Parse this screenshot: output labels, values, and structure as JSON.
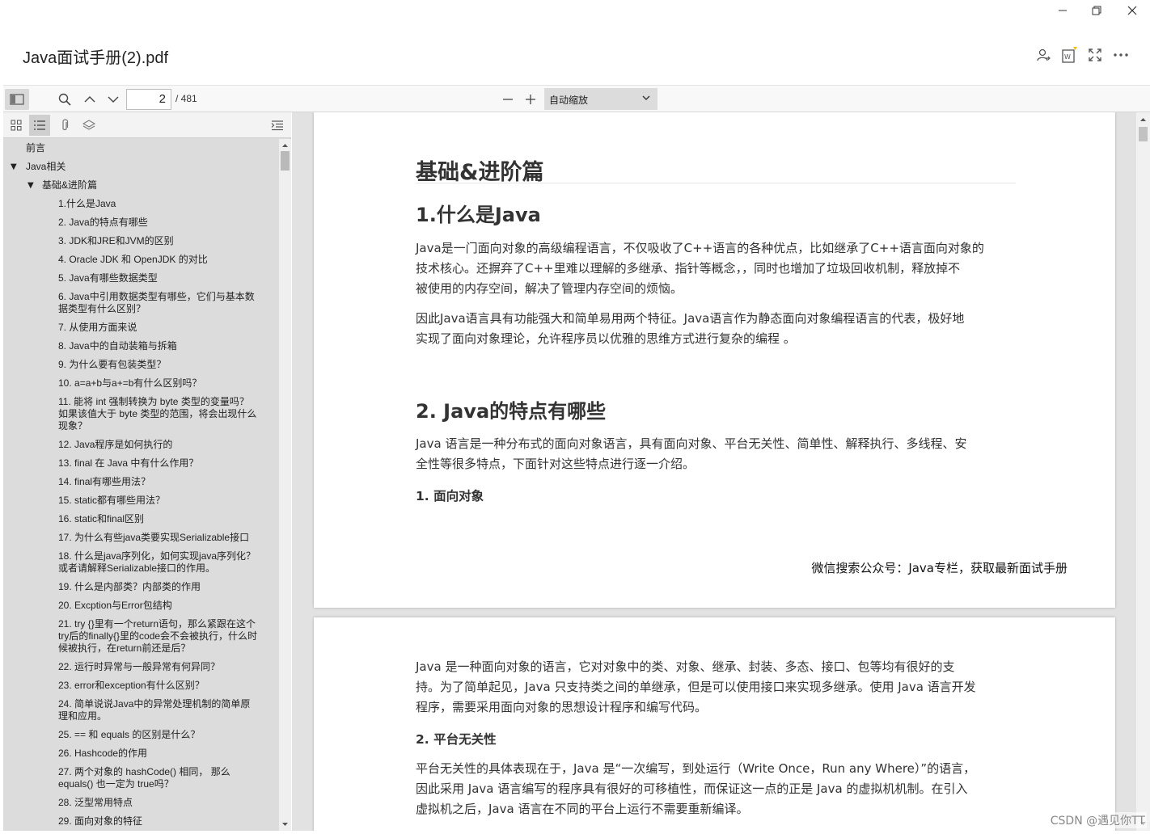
{
  "window": {
    "doc_title": "Java面试手册(2).pdf",
    "minimize_icon": "minimize-icon",
    "restore_icon": "restore-icon",
    "close_icon": "close-icon"
  },
  "toolbar": {
    "page_current": "2",
    "page_total": "/ 481",
    "zoom_label": "自动缩放"
  },
  "outline": {
    "items": [
      "前言",
      "Java相关",
      "基础&进阶篇",
      "1.什么是Java",
      "2. Java的特点有哪些",
      "3. JDK和JRE和JVM的区别",
      "4. Oracle JDK 和 OpenJDK 的对比",
      "5. Java有哪些数据类型",
      "6. Java中引用数据类型有哪些，它们与基本数",
      "据类型有什么区别？",
      "7. 从使用方面来说",
      "8. Java中的自动装箱与拆箱",
      "9. 为什么要有包装类型？",
      "10. a=a+b与a+=b有什么区别吗？",
      "11. 能将 int 强制转换为 byte 类型的变量吗？",
      "如果该值大于 byte 类型的范围，将会出现什么",
      "现象？",
      "12. Java程序是如何执行的",
      "13. final 在 Java 中有什么作用？",
      "14. final有哪些用法？",
      "15. static都有哪些用法？",
      "16. static和final区别",
      "17. 为什么有些java类要实现Serializable接口",
      "18. 什么是java序列化，如何实现java序列化？",
      "或者请解释Serializable接口的作用。",
      "19. 什么是内部类？内部类的作用",
      "20. Excption与Error包结构",
      "21. try {}里有一个return语句，那么紧跟在这个",
      "try后的finally{}里的code会不会被执行，什么时",
      "候被执行，在return前还是后？",
      "22. 运行时异常与一般异常有何异同？",
      "23. error和exception有什么区别？",
      "24. 简单说说Java中的异常处理机制的简单原",
      "理和应用。",
      "25. == 和 equals 的区别是什么？",
      "26. Hashcode的作用",
      "27. 两个对象的 hashCode() 相同， 那么",
      "equals() 也一定为 true吗？",
      "28. 泛型常用特点",
      "29. 面向对象的特征"
    ]
  },
  "page1": {
    "h1": "基础&进阶篇",
    "sec1_title": "1.什么是Java",
    "sec1_p1_l1": "Java是一门面向对象的高级编程语言，不仅吸收了C++语言的各种优点，比如继承了C++语言面向对象的",
    "sec1_p1_l2": "技术核心。还摒弃了C++里难以理解的多继承、指针等概念，，同时也增加了垃圾回收机制，释放掉不",
    "sec1_p1_l3": "被使用的内存空间，解决了管理内存空间的烦恼。",
    "sec1_p2_l1": "因此Java语言具有功能强大和简单易用两个特征。Java语言作为静态面向对象编程语言的代表，极好地",
    "sec1_p2_l2": "实现了面向对象理论，允许程序员以优雅的思维方式进行复杂的编程 。",
    "sec2_title": "2. Java的特点有哪些",
    "sec2_p1_l1": "Java 语言是一种分布式的面向对象语言，具有面向对象、平台无关性、简单性、解释执行、多线程、安",
    "sec2_p1_l2": "全性等很多特点，下面针对这些特点进行逐一介绍。",
    "sub1_title": "1. 面向对象",
    "footer": "微信搜索公众号：Java专栏，获取最新面试手册"
  },
  "page2": {
    "p1_l1": "Java 是一种面向对象的语言，它对对象中的类、对象、继承、封装、多态、接口、包等均有很好的支",
    "p1_l2": "持。为了简单起见，Java 只支持类之间的单继承，但是可以使用接口来实现多继承。使用 Java 语言开发",
    "p1_l3": "程序，需要采用面向对象的思想设计程序和编写代码。",
    "sub2_title": "2. 平台无关性",
    "p2_l1": "平台无关性的具体表现在于，Java 是“一次编写，到处运行（Write Once，Run any Where）”的语言，",
    "p2_l2": "因此采用 Java 语言编写的程序具有很好的可移植性，而保证这一点的正是 Java 的虚拟机机制。在引入",
    "p2_l3": "虚拟机之后，Java 语言在不同的平台上运行不需要重新编译。"
  },
  "watermark": "CSDN @遇见你TT"
}
